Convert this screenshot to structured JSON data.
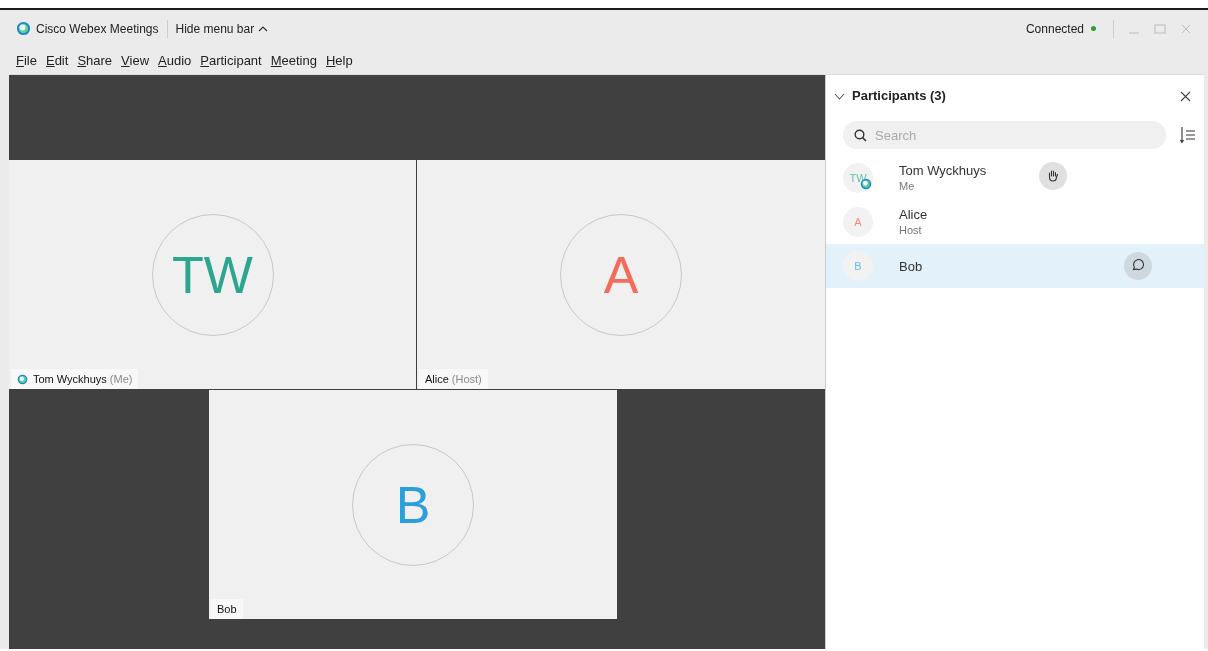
{
  "window": {
    "title": "Cisco Webex Meetings",
    "menu_toggle": "Hide menu bar",
    "status": "Connected",
    "connected": true
  },
  "menu": [
    {
      "label": "File"
    },
    {
      "label": "Edit"
    },
    {
      "label": "Share"
    },
    {
      "label": "View"
    },
    {
      "label": "Audio"
    },
    {
      "label": "Participant"
    },
    {
      "label": "Meeting"
    },
    {
      "label": "Help"
    }
  ],
  "videos": [
    {
      "initials": "TW",
      "color": "#2ea58f",
      "name": "Tom Wyckhuys",
      "role": "(Me)",
      "app_badge": true
    },
    {
      "initials": "A",
      "color": "#f26b5b",
      "name": "Alice",
      "role": "(Host)"
    },
    {
      "initials": "B",
      "color": "#2b9fdc",
      "name": "Bob"
    }
  ],
  "participants": {
    "title": "Participants (3)",
    "expanded": true,
    "search_placeholder": "Search",
    "items": [
      {
        "initials": "TW",
        "color": "#5cc4b0",
        "name": "Tom Wyckhuys",
        "role": "Me",
        "app_badge": true,
        "kind": "hand",
        "selected": false
      },
      {
        "initials": "A",
        "color": "#f58a80",
        "name": "Alice",
        "role": "Host",
        "kind": "plain",
        "selected": false
      },
      {
        "initials": "B",
        "color": "#6cb9e6",
        "name": "Bob",
        "kind": "chat",
        "selected": true
      }
    ]
  }
}
